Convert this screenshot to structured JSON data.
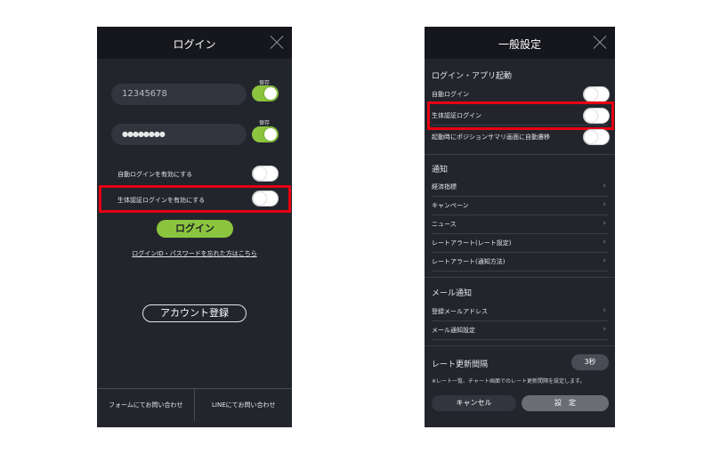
{
  "login_screen": {
    "title": "ログイン",
    "user_id_value": "12345678",
    "password_value": "●●●●●●●●",
    "save_label": "保存",
    "auto_login_label": "自動ログインを有効にする",
    "biometric_login_label": "生体認証ログインを有効にする",
    "login_button": "ログイン",
    "forgot_link": "ログインID・パスワードを忘れた方はこちら",
    "account_button": "アカウント登録",
    "contact_form": "フォームにてお問い合わせ",
    "contact_line": "LINEにてお問い合わせ",
    "toggles": {
      "save_id": true,
      "save_password": true,
      "auto_login": false,
      "biometric_login": false
    }
  },
  "settings_screen": {
    "title": "一般設定",
    "section_login": "ログイン・アプリ起動",
    "auto_login": "自動ログイン",
    "biometric_login": "生体認証ログイン",
    "startup_position": "起動時にポジションサマリ画面に自動遷移",
    "section_notify": "通知",
    "notify_items": [
      "経済指標",
      "キャンペーン",
      "ニュース",
      "レートアラート(レート設定)",
      "レートアラート(通知方法)"
    ],
    "section_mail": "メール通知",
    "mail_items": [
      "登録メールアドレス",
      "メール通知設定"
    ],
    "rate_label": "レート更新間隔",
    "rate_value": "3秒",
    "rate_note": "※レート一覧、チャート画面でのレート更新間隔を設定します。",
    "cancel_button": "キャンセル",
    "set_button": "設　定",
    "chevron": "›"
  },
  "colors": {
    "accent": "#8bc53f",
    "highlight": "#e60012",
    "panel": "#23252d"
  }
}
